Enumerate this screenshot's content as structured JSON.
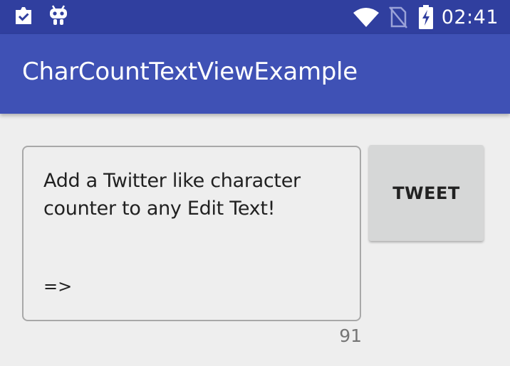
{
  "status_bar": {
    "time": "02:41",
    "icons": [
      "clipboard-check-icon",
      "android-robot-icon",
      "wifi-icon",
      "no-sim-icon",
      "battery-charging-icon"
    ]
  },
  "app_bar": {
    "title": "CharCountTextViewExample"
  },
  "main": {
    "edit_text": {
      "value": "Add a Twitter like character counter to any Edit Text!",
      "arrow": "=>"
    },
    "char_count": "91",
    "tweet_button_label": "TWEET"
  },
  "colors": {
    "status_bar": "#303f9f",
    "app_bar": "#3f51b5",
    "background": "#eeeeee",
    "button": "#d6d7d7"
  }
}
